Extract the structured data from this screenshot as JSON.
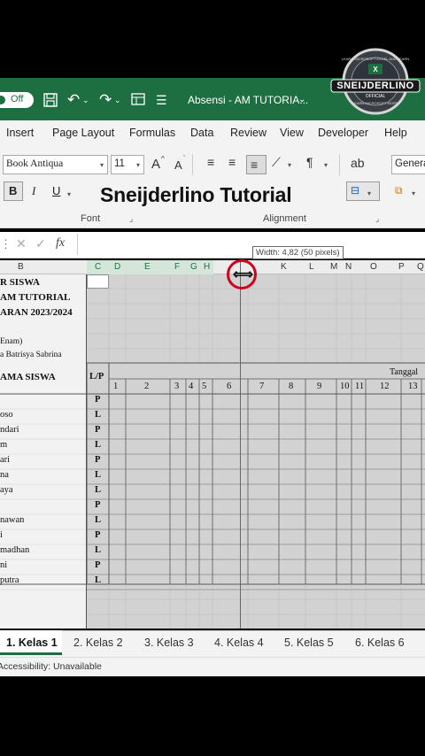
{
  "titlebar": {
    "autosave_label": "Off",
    "title": "Absensi - AM TUTORIA...",
    "save_icon": "save-icon",
    "undo_icon": "undo-icon",
    "redo_icon": "redo-icon"
  },
  "watermark": {
    "name": "SNEIJDERLINO",
    "ring_top": "LEARN MICROSOFT EXCEL AND LEARN",
    "official": "OFFICIAL",
    "ring_bottom": "LEARN MICROSOFT WORD"
  },
  "menu": [
    "Insert",
    "Page Layout",
    "Formulas",
    "Data",
    "Review",
    "View",
    "Developer",
    "Help"
  ],
  "ribbon": {
    "font_name": "Book Antiqua",
    "font_size": "11",
    "grow_font": "A",
    "shrink_font": "A",
    "bold": "B",
    "italic": "I",
    "underline": "U",
    "number_format": "Genera",
    "group_font": "Font",
    "group_alignment": "Alignment"
  },
  "overlay_caption": "Sneijderlino Tutorial",
  "formula_bar": {
    "fx": "fx",
    "value": ""
  },
  "tooltip": "Width: 4,82 (50 pixels)",
  "columns": {
    "B": "B",
    "C": "C",
    "D": "D",
    "E": "E",
    "F": "F",
    "G": "G",
    "H": "H",
    "K": "K",
    "L": "L",
    "M": "M",
    "N": "N",
    "O": "O",
    "P": "P",
    "Q": "Q"
  },
  "sheet": {
    "title_lines": [
      "R SISWA",
      "AM TUTORIAL",
      "ARAN 2023/2024"
    ],
    "class_info": [
      "Enam)",
      "a Batrisya Sabrina"
    ],
    "header_name": "AMA SISWA",
    "header_lp": "L/P",
    "header_tanggal": "Tanggal",
    "day_numbers": [
      "1",
      "2",
      "3",
      "4",
      "5",
      "6",
      "7",
      "8",
      "9",
      "10",
      "11",
      "12",
      "13"
    ],
    "students": [
      {
        "name": "",
        "lp": "P"
      },
      {
        "name": "oso",
        "lp": "L"
      },
      {
        "name": "ndari",
        "lp": "P"
      },
      {
        "name": "m",
        "lp": "L"
      },
      {
        "name": "ari",
        "lp": "P"
      },
      {
        "name": "na",
        "lp": "L"
      },
      {
        "name": "aya",
        "lp": "L"
      },
      {
        "name": "",
        "lp": "P"
      },
      {
        "name": "nawan",
        "lp": "L"
      },
      {
        "name": "i",
        "lp": "P"
      },
      {
        "name": "madhan",
        "lp": "L"
      },
      {
        "name": "ni",
        "lp": "P"
      },
      {
        "name": "putra",
        "lp": "L"
      }
    ]
  },
  "tabs": [
    "1. Kelas 1",
    "2. Kelas 2",
    "3. Kelas 3",
    "4. Kelas 4",
    "5. Kelas 5",
    "6. Kelas 6"
  ],
  "active_tab": "1. Kelas 1",
  "status": "Accessibility: Unavailable",
  "colors": {
    "excel_green": "#1d6f42",
    "cursor_ring": "#d0021b"
  }
}
